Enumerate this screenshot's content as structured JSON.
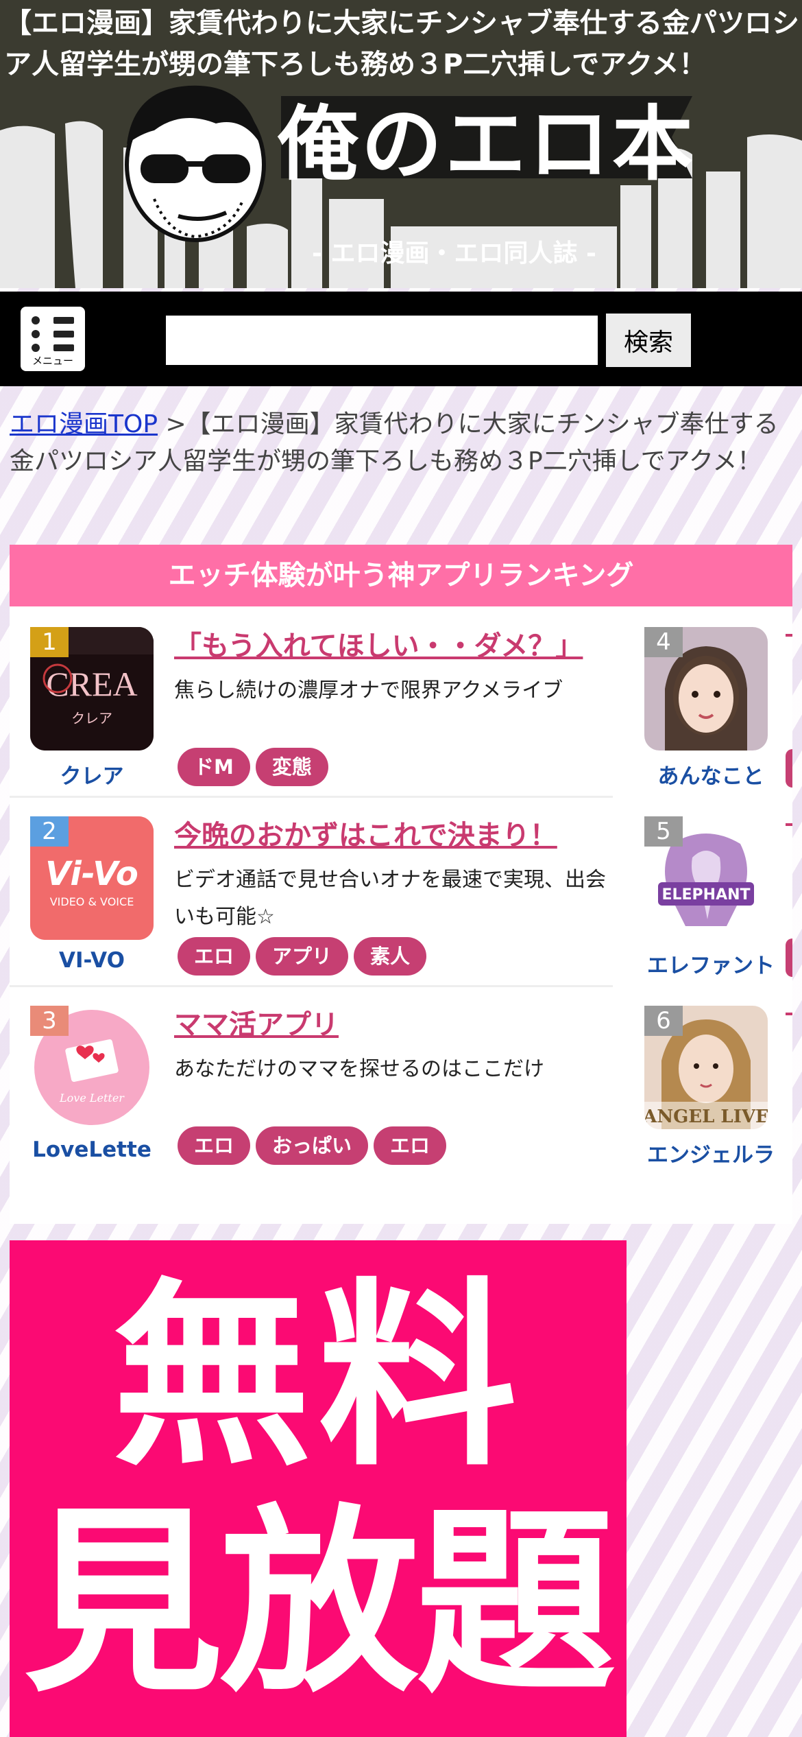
{
  "site": {
    "title": "【エロ漫画】家賃代わりに大家にチンシャブ奉仕する金パツロシア人留学生が甥の筆下ろしも務め３P二穴挿しでアクメ！",
    "logo_main": "俺のエロ本",
    "logo_sub": "- エロ漫画・エロ同人誌 -"
  },
  "toolbar": {
    "menu_label": "メニュー",
    "search_placeholder": "",
    "search_button": "検索"
  },
  "breadcrumb": {
    "home_label": "エロ漫画TOP",
    "separator": ">",
    "current": "【エロ漫画】家賃代わりに大家にチンシャブ奉仕する金パツロシア人留学生が甥の筆下ろしも務め３P二穴挿しでアクメ！"
  },
  "ranking": {
    "heading": "エッチ体験が叶う神アプリランキング",
    "items": [
      {
        "rank": "1",
        "name": "クレア",
        "title": "「もう入れてほしい・・ダメ？」",
        "desc": "焦らし続けの濃厚オナで限界アクメライブ",
        "tags": [
          "ドM",
          "変態"
        ],
        "badge_color": "#d4a017",
        "icon_text": "CREA",
        "icon_sub": "クレア"
      },
      {
        "rank": "2",
        "name": "VI-VO",
        "title": "今晩のおかずはこれで決まり！",
        "desc": "ビデオ通話で見せ合いオナを最速で実現、出会いも可能☆",
        "tags": [
          "エロ",
          "アプリ",
          "素人"
        ],
        "badge_color": "#5b9fe0",
        "icon_text": "Vi-Vo",
        "icon_sub": "VIDEO & VOICE"
      },
      {
        "rank": "3",
        "name": "LoveLette",
        "title": "ママ活アプリ",
        "desc": "あなただけのママを探せるのはここだけ",
        "tags": [
          "エロ",
          "おっぱい",
          "エロ"
        ],
        "badge_color": "#e98b78",
        "icon_text": "Love Letter"
      }
    ],
    "right_items": [
      {
        "rank": "4",
        "name": "あんなこと"
      },
      {
        "rank": "5",
        "name": "エレファント",
        "icon_text": "ELEPHANT"
      },
      {
        "rank": "6",
        "name": "エンジェルラ",
        "icon_text": "ANGEL LIVE"
      }
    ]
  },
  "ad": {
    "line1": "無料",
    "line2": "見放題"
  }
}
